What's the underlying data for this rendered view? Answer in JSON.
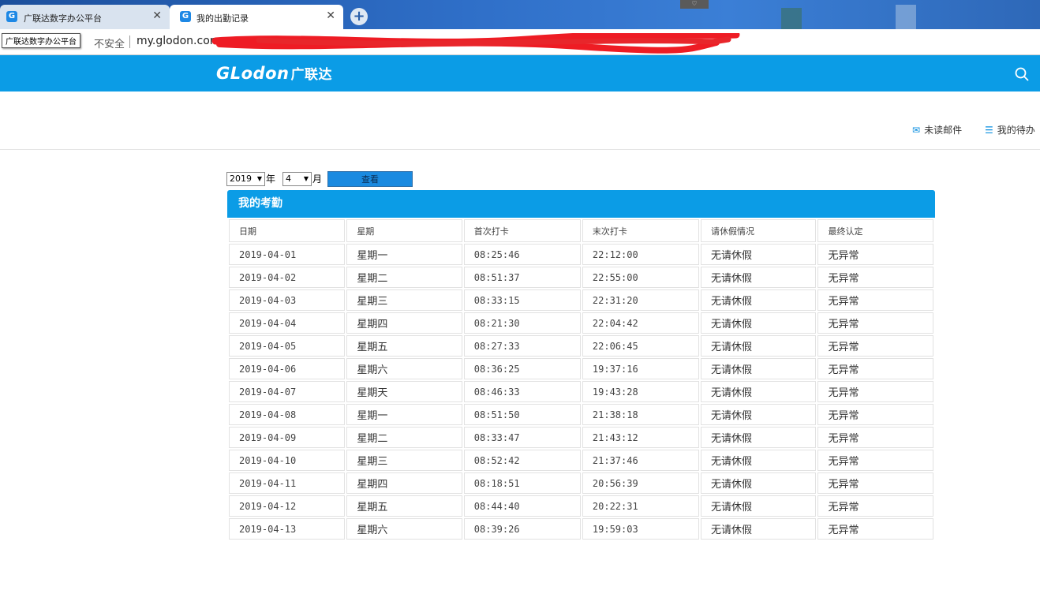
{
  "browser": {
    "tabs": [
      {
        "title": "广联达数字办公平台",
        "active": false
      },
      {
        "title": "我的出勤记录",
        "active": true
      }
    ],
    "tooltip": "广联达数字办公平台",
    "security_label": "不安全",
    "url": "my.glodon.com"
  },
  "header": {
    "logo_en": "GLodon",
    "logo_cn": "广联达"
  },
  "toolbar": {
    "mail_label": "未读邮件",
    "todo_label": "我的待办"
  },
  "filter": {
    "year": "2019",
    "year_label": "年",
    "month": "4",
    "month_label": "月",
    "view_button": "查看"
  },
  "attendance": {
    "title": "我的考勤",
    "columns": [
      "日期",
      "星期",
      "首次打卡",
      "末次打卡",
      "请休假情况",
      "最终认定"
    ],
    "rows": [
      [
        "2019-04-01",
        "星期一",
        "08:25:46",
        "22:12:00",
        "无请休假",
        "无异常"
      ],
      [
        "2019-04-02",
        "星期二",
        "08:51:37",
        "22:55:00",
        "无请休假",
        "无异常"
      ],
      [
        "2019-04-03",
        "星期三",
        "08:33:15",
        "22:31:20",
        "无请休假",
        "无异常"
      ],
      [
        "2019-04-04",
        "星期四",
        "08:21:30",
        "22:04:42",
        "无请休假",
        "无异常"
      ],
      [
        "2019-04-05",
        "星期五",
        "08:27:33",
        "22:06:45",
        "无请休假",
        "无异常"
      ],
      [
        "2019-04-06",
        "星期六",
        "08:36:25",
        "19:37:16",
        "无请休假",
        "无异常"
      ],
      [
        "2019-04-07",
        "星期天",
        "08:46:33",
        "19:43:28",
        "无请休假",
        "无异常"
      ],
      [
        "2019-04-08",
        "星期一",
        "08:51:50",
        "21:38:18",
        "无请休假",
        "无异常"
      ],
      [
        "2019-04-09",
        "星期二",
        "08:33:47",
        "21:43:12",
        "无请休假",
        "无异常"
      ],
      [
        "2019-04-10",
        "星期三",
        "08:52:42",
        "21:37:46",
        "无请休假",
        "无异常"
      ],
      [
        "2019-04-11",
        "星期四",
        "08:18:51",
        "20:56:39",
        "无请休假",
        "无异常"
      ],
      [
        "2019-04-12",
        "星期五",
        "08:44:40",
        "20:22:31",
        "无请休假",
        "无异常"
      ],
      [
        "2019-04-13",
        "星期六",
        "08:39:26",
        "19:59:03",
        "无请休假",
        "无异常"
      ]
    ]
  },
  "colors": {
    "brand_blue": "#0b9ce6",
    "redaction": "#ee1c24"
  }
}
